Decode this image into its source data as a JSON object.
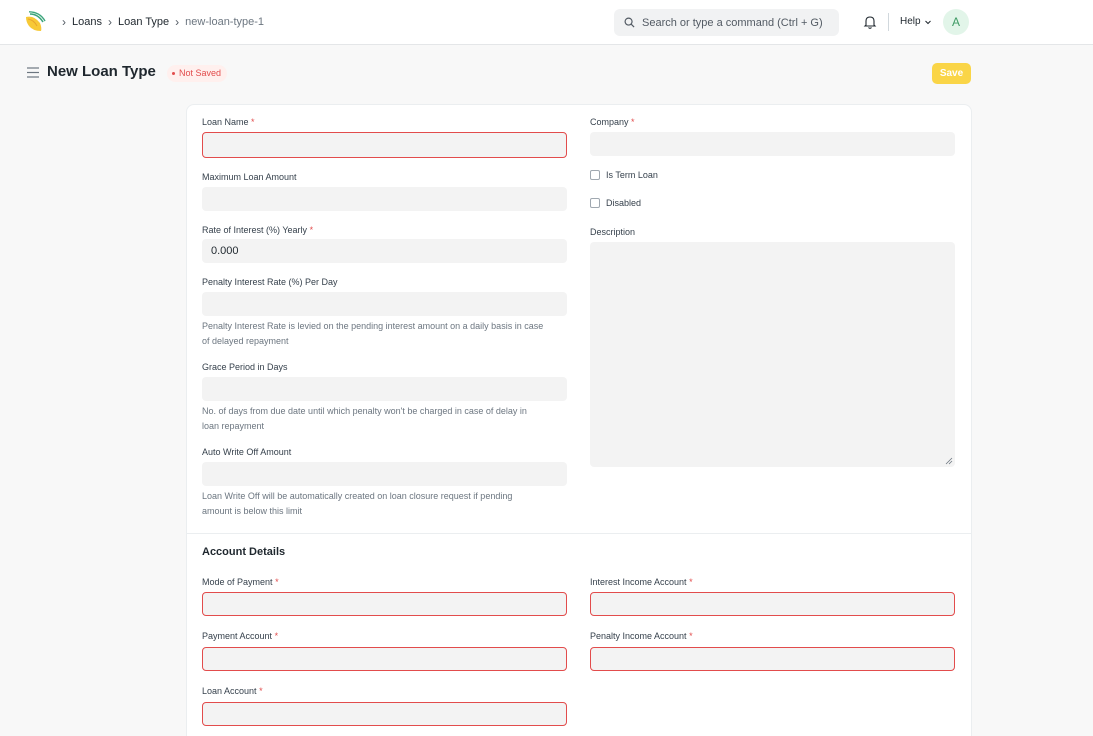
{
  "navbar": {
    "breadcrumbs": [
      "Loans",
      "Loan Type",
      "new-loan-type-1"
    ],
    "search_placeholder": "Search or type a command (Ctrl + G)",
    "help_label": "Help",
    "avatar_letter": "A"
  },
  "page": {
    "title": "New Loan Type",
    "status": "Not Saved",
    "save_label": "Save"
  },
  "form": {
    "loan_name": {
      "label": "Loan Name",
      "value": ""
    },
    "company": {
      "label": "Company",
      "value": ""
    },
    "maximum_loan_amount": {
      "label": "Maximum Loan Amount",
      "value": ""
    },
    "is_term_loan": {
      "label": "Is Term Loan",
      "checked": false
    },
    "disabled": {
      "label": "Disabled",
      "checked": false
    },
    "rate_of_interest": {
      "label": "Rate of Interest (%) Yearly",
      "value": "0.000"
    },
    "description": {
      "label": "Description",
      "value": ""
    },
    "penalty_interest_rate": {
      "label": "Penalty Interest Rate (%) Per Day",
      "value": "",
      "help_line1": "Penalty Interest Rate is levied on the pending interest amount on a daily basis in case",
      "help_line2": "of delayed repayment"
    },
    "grace_period": {
      "label": "Grace Period in Days",
      "value": "",
      "help_line1": "No. of days from due date until which penalty won't be charged in case of delay in",
      "help_line2": "loan repayment"
    },
    "auto_write_off": {
      "label": "Auto Write Off Amount",
      "value": "",
      "help_line1": "Loan Write Off will be automatically created on loan closure request if pending",
      "help_line2": "amount is below this limit"
    },
    "required_marker": "*"
  },
  "account_details": {
    "title": "Account Details",
    "mode_of_payment": {
      "label": "Mode of Payment",
      "value": ""
    },
    "interest_income_account": {
      "label": "Interest Income Account",
      "value": ""
    },
    "payment_account": {
      "label": "Payment Account",
      "value": ""
    },
    "penalty_income_account": {
      "label": "Penalty Income Account",
      "value": ""
    },
    "loan_account": {
      "label": "Loan Account",
      "value": ""
    }
  },
  "colors": {
    "accent_save": "#fad547",
    "error": "#e24c4c",
    "input_bg": "#f3f3f3"
  },
  "icons": [
    "app-logo-icon",
    "chevron-right-icon",
    "search-icon",
    "bell-icon",
    "chevron-down-icon",
    "hamburger-icon",
    "resize-grip-icon"
  ]
}
